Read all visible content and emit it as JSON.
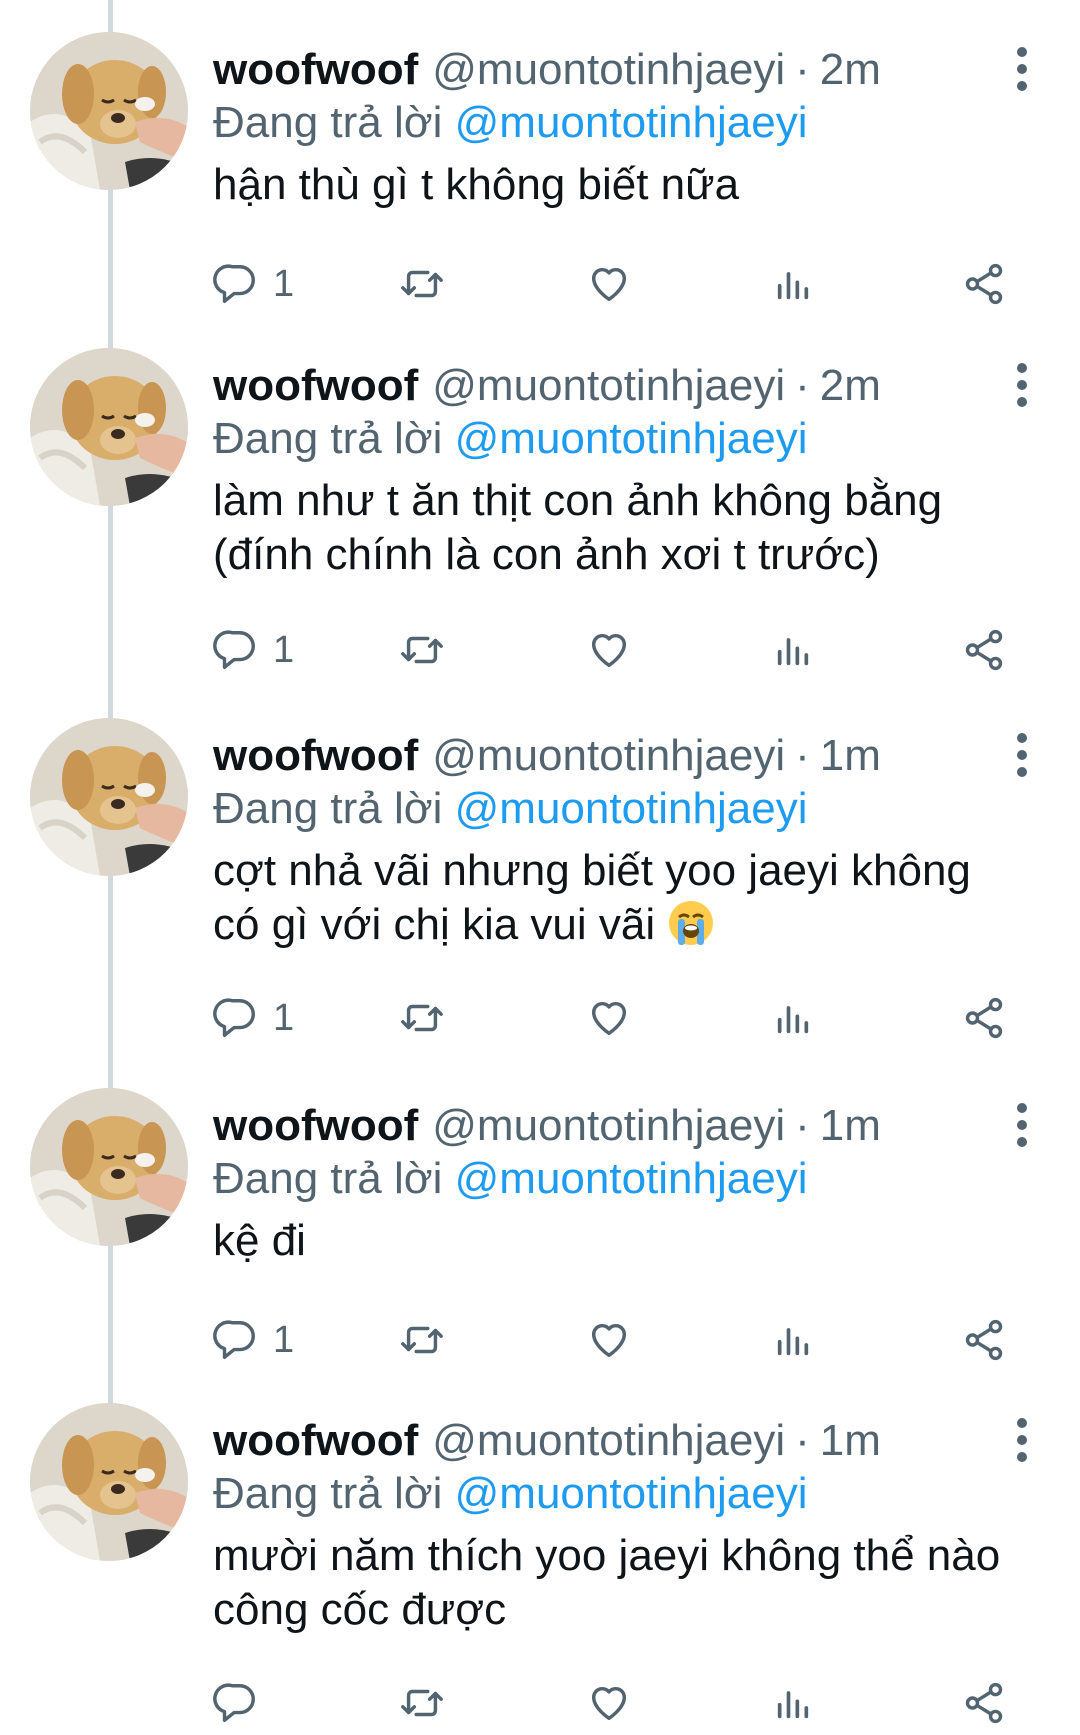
{
  "tweets": [
    {
      "name": "woofwoof",
      "handle": "@muontotinhjaeyi",
      "separator": "·",
      "time": "2m",
      "replying_prefix": "Đang trả lời ",
      "replying_to": "@muontotinhjaeyi",
      "text": "hận thù gì t không biết nữa",
      "reply_count": "1"
    },
    {
      "name": "woofwoof",
      "handle": "@muontotinhjaeyi",
      "separator": "·",
      "time": "2m",
      "replying_prefix": "Đang trả lời ",
      "replying_to": "@muontotinhjaeyi",
      "text": "làm như t ăn thịt con ảnh không bằng\n(đính chính là con ảnh xơi t trước)",
      "reply_count": "1"
    },
    {
      "name": "woofwoof",
      "handle": "@muontotinhjaeyi",
      "separator": "·",
      "time": "1m",
      "replying_prefix": "Đang trả lời ",
      "replying_to": "@muontotinhjaeyi",
      "text": "cợt nhả vãi nhưng biết yoo jaeyi không\ncó gì với chị kia vui vãi ",
      "emoji": "loudly-crying-face-emoji",
      "reply_count": "1"
    },
    {
      "name": "woofwoof",
      "handle": "@muontotinhjaeyi",
      "separator": "·",
      "time": "1m",
      "replying_prefix": "Đang trả lời ",
      "replying_to": "@muontotinhjaeyi",
      "text": "kệ đi",
      "reply_count": "1"
    },
    {
      "name": "woofwoof",
      "handle": "@muontotinhjaeyi",
      "separator": "·",
      "time": "1m",
      "replying_prefix": "Đang trả lời ",
      "replying_to": "@muontotinhjaeyi",
      "text": "mười năm thích yoo jaeyi không thể nào\ncông cốc được",
      "reply_count": ""
    }
  ],
  "icons": {
    "reply": "speech-bubble-icon",
    "retweet": "retweet-icon",
    "like": "heart-icon",
    "stats": "bar-chart-icon",
    "share": "share-icon",
    "more": "vertical-dots-icon"
  },
  "colors": {
    "text": "#0f1419",
    "secondary": "#536471",
    "link": "#1d9bf0",
    "thread_line": "#cfd9de"
  }
}
